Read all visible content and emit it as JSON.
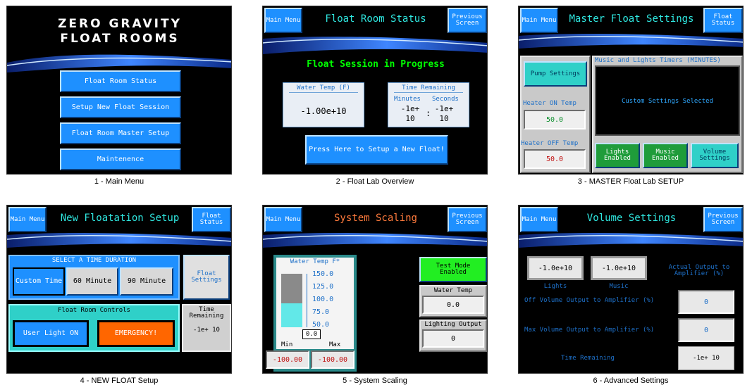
{
  "colors": {
    "accent": "#1e90ff",
    "title": "#2fe7e0",
    "green_text": "#00ff00",
    "orange_title": "#ff7a3c",
    "emergency": "#ff6600",
    "green_btn": "#1f9c3a",
    "test_mode": "#22ee22"
  },
  "s1": {
    "logo_line1": "ZERO GRAVITY",
    "logo_line2": "FLOAT ROOMS",
    "buttons": [
      "Float Room Status",
      "Setup New Float Session",
      "Float Room Master Setup",
      "Maintenence"
    ],
    "caption": "1 - Main Menu"
  },
  "s2": {
    "main_menu": "Main Menu",
    "prev": "Previous Screen",
    "title": "Float Room Status",
    "status": "Float Session in Progress",
    "water_label": "Water Temp (F)",
    "water_value": "-1.00e+10",
    "time_label": "Time Remaining",
    "minutes_label": "Minutes",
    "seconds_label": "Seconds",
    "minutes_value": "-1e+ 10",
    "seconds_value": "-1e+ 10",
    "colon": ":",
    "setup_button": "Press Here to Setup a New Float!",
    "caption": "2 - Float Lab Overview"
  },
  "s3": {
    "main_menu": "Main Menu",
    "float_status": "Float Status",
    "title": "Master Float Settings",
    "pump": "Pump Settings",
    "heater_on_label": "Heater ON Temp",
    "heater_on_value": "50.0",
    "heater_off_label": "Heater OFF Temp",
    "heater_off_value": "50.0",
    "timers_label": "Music and Lights Timers (MINUTES)",
    "custom": "Custom Settings Selected",
    "lights_btn": "Lights Enabled",
    "music_btn": "Music Enabled",
    "volume_btn": "Volume Settings",
    "caption": "3 - MASTER Float Lab SETUP"
  },
  "s4": {
    "main_menu": "Main Menu",
    "float_status": "Float Status",
    "title": "New Floatation Setup",
    "duration_label": "SELECT A TIME DURATION",
    "custom": "Custom Time",
    "m60": "60 Minute",
    "m90": "90 Minute",
    "float_settings": "Float Settings",
    "controls_label": "Float Room Controls",
    "user_light": "User Light ON",
    "emergency": "EMERGENCY!",
    "time_label": "Time Remaining",
    "time_value": "-1e+ 10",
    "caption": "4 - NEW FLOAT Setup"
  },
  "s5": {
    "main_menu": "Main Menu",
    "prev": "Previous Screen",
    "title": "System Scaling",
    "gauge_label": "Water Temp F*",
    "ticks": [
      "150.0",
      "125.0",
      "100.0",
      "75.0",
      "50.0"
    ],
    "gauge_value": "0.0",
    "min_label": "Min",
    "max_label": "Max",
    "min_value": "-100.00",
    "max_value": "-100.00",
    "test_mode": "Test Mode Enabled",
    "water_label": "Water Temp",
    "water_value": "0.0",
    "lighting_label": "Lighting Output",
    "lighting_value": "0",
    "caption": "5 - System Scaling"
  },
  "s6": {
    "main_menu": "Main Menu",
    "prev": "Previous Screen",
    "title": "Volume Settings",
    "lights_value": "-1.0e+10",
    "music_value": "-1.0e+10",
    "lights_label": "Lights",
    "music_label": "Music",
    "actual_label": "Actual Output to Amplifier (%)",
    "off_label": "Off Volume Output to Amplifier (%)",
    "off_value": "0",
    "max_label": "Max Volume Output to Amplifier (%)",
    "max_value": "0",
    "time_label": "Time Remaining",
    "time_value": "-1e+ 10",
    "caption": "6 - Advanced Settings"
  }
}
